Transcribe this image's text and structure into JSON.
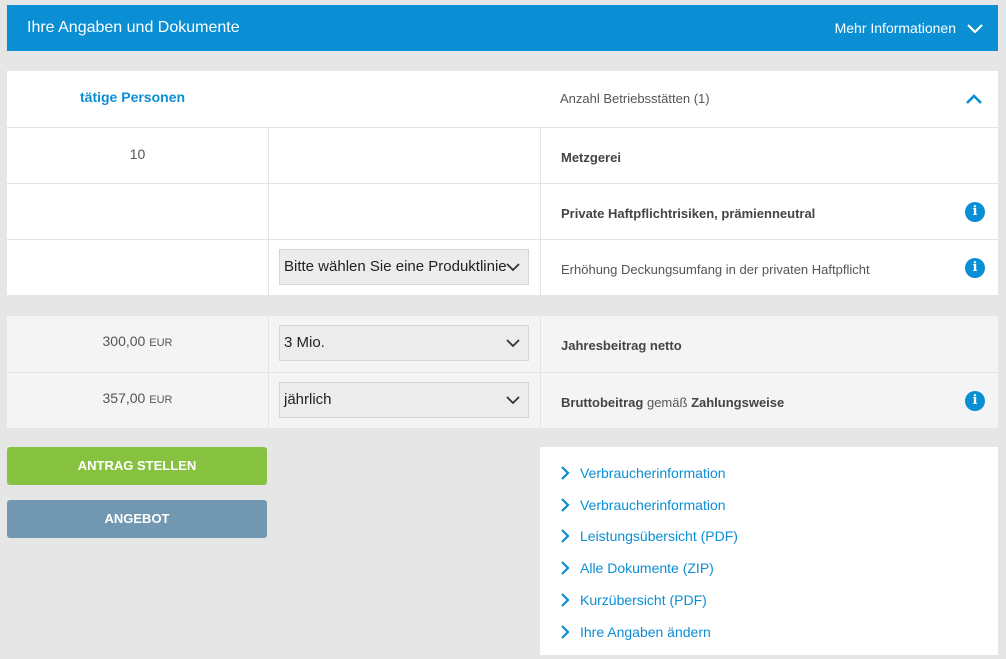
{
  "header": {
    "title": "Ihre Angaben und Dokumente",
    "more_label": "Mehr Informationen"
  },
  "table": {
    "col1_heading": "tätige Personen",
    "col3_heading": "Anzahl Betriebsstätten (1)",
    "rows": [
      {
        "c1": "10",
        "c3": "Metzgerei"
      },
      {
        "c1": "",
        "c3": "Private Haftpflichtrisiken, prämienneutral"
      },
      {
        "c1": "",
        "select": "Bitte wählen Sie eine Produktlinie",
        "c3": "Erhöhung Deckungsumfang in der privaten Haftpflicht"
      }
    ]
  },
  "pricing": {
    "rows": [
      {
        "amount": "300,00",
        "currency": "EUR",
        "select": "3 Mio.",
        "label": "Jahresbeitrag netto"
      },
      {
        "amount": "357,00",
        "currency": "EUR",
        "select": "jährlich",
        "label_b1": "Bruttobeitrag",
        "label_mid": "gemäß",
        "label_b2": "Zahlungsweise"
      }
    ]
  },
  "buttons": {
    "apply": "ANTRAG STELLEN",
    "offer": "ANGEBOT"
  },
  "links": [
    "Verbraucherinformation",
    "Verbraucherinformation",
    "Leistungsübersicht (PDF)",
    "Alle Dokumente (ZIP)",
    "Kurzübersicht (PDF)",
    "Ihre Angaben ändern"
  ],
  "icons": {
    "info": "info-icon",
    "chevron_down": "chevron-down-icon",
    "chevron_up": "chevron-up-icon",
    "chevron_right": "chevron-right-icon"
  },
  "colors": {
    "brand_blue": "#0a8fd4",
    "button_green": "#86c23f",
    "button_grey": "#7298b1"
  }
}
